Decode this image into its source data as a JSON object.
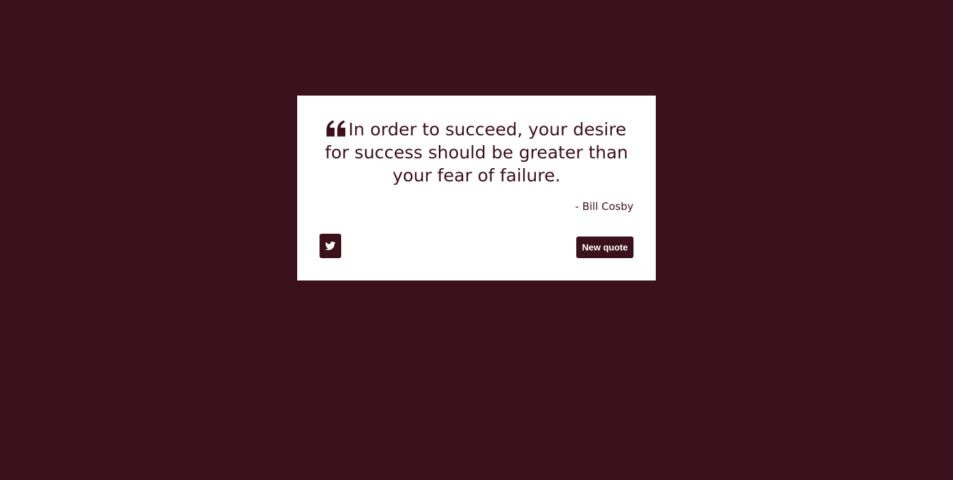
{
  "quote": {
    "text": "In order to succeed, your desire for success should be greater than your fear of failure.",
    "author": "- Bill Cosby",
    "icon": "quote-left-icon"
  },
  "controls": {
    "tweet_icon": "twitter-icon",
    "new_quote_label": "New quote"
  },
  "colors": {
    "background": "#3a111c",
    "card": "#ffffff",
    "accent": "#3a111c"
  }
}
